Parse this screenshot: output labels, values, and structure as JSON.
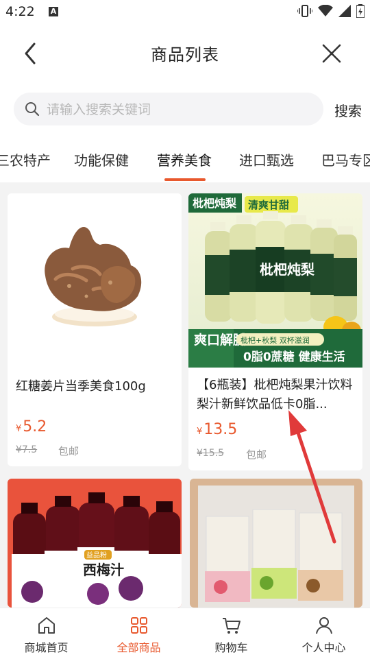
{
  "status_bar": {
    "time": "4:22",
    "notif_icon": "A"
  },
  "header": {
    "title": "商品列表"
  },
  "search": {
    "placeholder": "请输入搜索关键词",
    "button_label": "搜索"
  },
  "categories": [
    "三农特产",
    "功能保健",
    "营养美食",
    "进口甄选",
    "巴马专区"
  ],
  "active_category": "营养美食",
  "products": [
    {
      "name": "红糖姜片当季美食100g",
      "currency": "¥",
      "price": "5.2",
      "original_price": "¥7.5",
      "shipping": "包邮"
    },
    {
      "name": "【6瓶装】枇杷炖梨果汁饮料梨汁新鲜饮品低卡0脂...",
      "currency": "¥",
      "price": "13.5",
      "original_price": "¥15.5",
      "shipping": "包邮",
      "image_text": {
        "tag_left": "枇杷炖梨",
        "tag_right": "清爽甘甜",
        "bottle_label": "枇杷炖梨",
        "badge": "爽口解腻",
        "sub": "枇杷+秋梨 双杯滋润",
        "slogan": "0脂0蔗糖 健康生活"
      }
    },
    {
      "name": "",
      "image_text": {
        "bottle_label": "西梅汁",
        "brand": "益品粉"
      }
    },
    {
      "name": ""
    }
  ],
  "tabbar": [
    {
      "label": "商城首页",
      "icon": "home-icon"
    },
    {
      "label": "全部商品",
      "icon": "grid-icon"
    },
    {
      "label": "购物车",
      "icon": "cart-icon"
    },
    {
      "label": "个人中心",
      "icon": "user-icon"
    }
  ],
  "colors": {
    "accent": "#e8582d"
  }
}
